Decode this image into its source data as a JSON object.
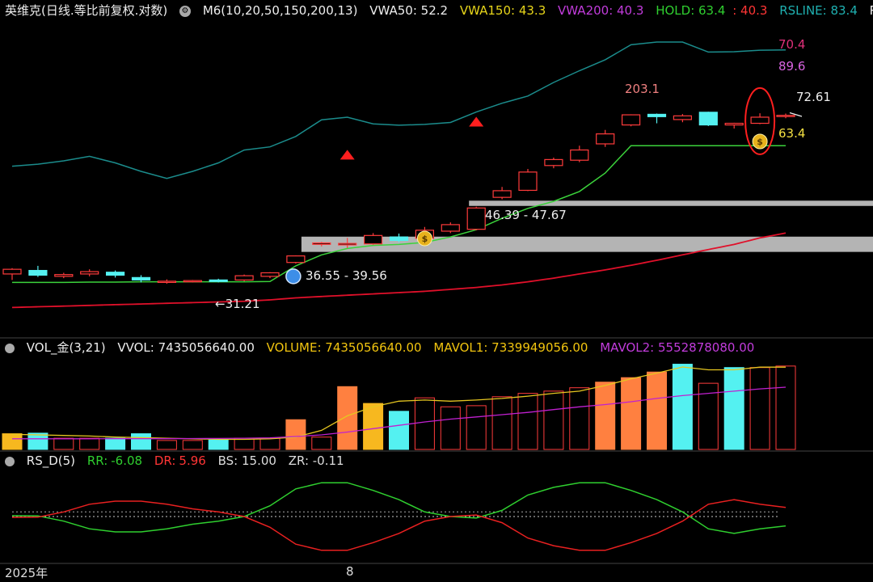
{
  "header_main": {
    "title": "英维克(日线.等比前复权.对数)",
    "m6": "M6(10,20,50,150,200,13)",
    "vwa50": "VWA50: 52.2",
    "vwa150": "VWA150: 43.3",
    "vwa200": "VWA200: 40.3",
    "hold": "HOLD: 63.4",
    "hold2": ": 40.3",
    "rsline": "RSLINE: 83.4",
    "rs_cut": "RS"
  },
  "header_vol": {
    "name": "VOL_金(3,21)",
    "vvol": "VVOL: 7435056640.00",
    "volume": "VOLUME: 7435056640.00",
    "mavol1": "MAVOL1: 7339949056.00",
    "mavol2": "MAVOL2: 5552878080.00"
  },
  "header_rs": {
    "name": "RS_D(5)",
    "rr_label": "RR:",
    "rr": "-6.08",
    "dr_label": "DR:",
    "dr": "5.96",
    "bs": "BS: 15.00",
    "zr": "ZR: -0.11"
  },
  "labels": {
    "l7041": "70.4",
    "l896": "89.6",
    "l2031": "203.1",
    "l7261": "72.61",
    "l634": "63.4",
    "l4639": "46.39 - 47.67",
    "l3655": "36.55 - 39.56",
    "l3121": "←31.21"
  },
  "dates": {
    "d1": "2025年",
    "d2": "8"
  },
  "colors": {
    "up": "#ff3b3b",
    "down": "#54f1f1",
    "hold": "#3bd23b",
    "rsline": "#1b8c8c",
    "vwa200": "#e0102a",
    "gold": "#f7b81f",
    "orange": "#ff8040",
    "magenta": "#c020d0"
  },
  "chart_data": [
    {
      "type": "candlestick",
      "title": "英维克(日线.等比前复权.对数)",
      "scale": "log",
      "candles": [
        {
          "o": 32.6,
          "h": 33.6,
          "l": 31.6,
          "c": 33.4
        },
        {
          "o": 33.2,
          "h": 34.0,
          "l": 32.1,
          "c": 32.4
        },
        {
          "o": 32.2,
          "h": 32.8,
          "l": 31.9,
          "c": 32.5
        },
        {
          "o": 32.6,
          "h": 33.4,
          "l": 32.2,
          "c": 33.0
        },
        {
          "o": 32.9,
          "h": 33.2,
          "l": 32.0,
          "c": 32.4
        },
        {
          "o": 32.0,
          "h": 32.4,
          "l": 31.2,
          "c": 31.6
        },
        {
          "o": 31.2,
          "h": 31.7,
          "l": 31.0,
          "c": 31.4
        },
        {
          "o": 31.4,
          "h": 31.6,
          "l": 31.2,
          "c": 31.5
        },
        {
          "o": 31.6,
          "h": 31.8,
          "l": 31.21,
          "c": 31.35
        },
        {
          "o": 31.6,
          "h": 32.5,
          "l": 31.4,
          "c": 32.3
        },
        {
          "o": 32.2,
          "h": 32.9,
          "l": 31.9,
          "c": 32.8
        },
        {
          "o": 34.6,
          "h": 35.9,
          "l": 34.4,
          "c": 35.8
        },
        {
          "o": 38.0,
          "h": 38.5,
          "l": 37.6,
          "c": 38.3
        },
        {
          "o": 37.9,
          "h": 39.3,
          "l": 37.3,
          "c": 38.2
        },
        {
          "o": 38.1,
          "h": 40.3,
          "l": 37.9,
          "c": 39.8
        },
        {
          "o": 39.5,
          "h": 40.2,
          "l": 38.4,
          "c": 38.8
        },
        {
          "o": 39.2,
          "h": 41.6,
          "l": 38.9,
          "c": 40.9
        },
        {
          "o": 40.7,
          "h": 42.6,
          "l": 40.3,
          "c": 42.1
        },
        {
          "o": 41.1,
          "h": 46.2,
          "l": 40.9,
          "c": 45.9
        },
        {
          "o": 48.5,
          "h": 51.2,
          "l": 48.0,
          "c": 50.2
        },
        {
          "o": 50.3,
          "h": 56.2,
          "l": 50.1,
          "c": 55.3
        },
        {
          "o": 57.2,
          "h": 59.6,
          "l": 56.4,
          "c": 59.0
        },
        {
          "o": 58.8,
          "h": 63.4,
          "l": 58.2,
          "c": 62.0
        },
        {
          "o": 64.0,
          "h": 68.8,
          "l": 63.0,
          "c": 67.4
        },
        {
          "o": 70.6,
          "h": 74.6,
          "l": 70.1,
          "c": 74.4
        },
        {
          "o": 74.6,
          "h": 74.9,
          "l": 71.2,
          "c": 73.7
        },
        {
          "o": 72.6,
          "h": 74.7,
          "l": 71.6,
          "c": 74.0
        },
        {
          "o": 75.4,
          "h": 75.6,
          "l": 70.2,
          "c": 70.6
        },
        {
          "o": 70.6,
          "h": 71.4,
          "l": 69.3,
          "c": 71.2
        },
        {
          "o": 71.2,
          "h": 75.0,
          "l": 70.9,
          "c": 73.5
        },
        {
          "o": 73.8,
          "h": 74.9,
          "l": 73.1,
          "c": 74.2
        }
      ],
      "lines": {
        "HOLD": [
          31.2,
          31.2,
          31.2,
          31.25,
          31.25,
          31.3,
          31.3,
          31.3,
          31.3,
          31.3,
          31.35,
          34.0,
          36.0,
          37.2,
          37.8,
          38.0,
          38.4,
          39.5,
          41.0,
          43.5,
          45.8,
          47.5,
          50.0,
          55.0,
          63.4,
          63.4,
          63.4,
          63.4,
          63.4,
          63.4,
          63.4
        ],
        "RSLINE": [
          57.0,
          57.6,
          58.6,
          60.0,
          58.0,
          55.5,
          53.5,
          55.5,
          58.0,
          62.0,
          63.0,
          66.5,
          72.5,
          73.5,
          71.0,
          70.5,
          70.8,
          71.5,
          75.5,
          79.0,
          82.0,
          88.0,
          93.5,
          99.0,
          107.0,
          108.5,
          108.5,
          103.0,
          103.2,
          104.0,
          104.2
        ],
        "VWA200": [
          27.4,
          27.5,
          27.6,
          27.7,
          27.8,
          27.9,
          28.0,
          28.1,
          28.2,
          28.3,
          28.5,
          28.8,
          29.0,
          29.2,
          29.4,
          29.6,
          29.8,
          30.1,
          30.4,
          30.8,
          31.3,
          31.9,
          32.6,
          33.3,
          34.1,
          35.0,
          36.0,
          37.0,
          38.0,
          39.3,
          40.3
        ]
      },
      "zones": [
        "46.39 - 47.67",
        "36.55 - 39.56"
      ],
      "annotations": [
        "70.4",
        "89.6",
        "203.1",
        "72.61",
        "63.4",
        "←31.21"
      ]
    },
    {
      "type": "bar",
      "title": "VOL_金(3,21)",
      "ylim": [
        0,
        8000000000
      ],
      "values": [
        1400000000,
        1450000000,
        1000000000,
        1000000000,
        1000000000,
        1400000000,
        800000000,
        800000000,
        850000000,
        1000000000,
        1000000000,
        2650000000,
        1100000000,
        5600000000,
        4100000000,
        3400000000,
        4600000000,
        3800000000,
        3900000000,
        4700000000,
        5000000000,
        5200000000,
        5500000000,
        6000000000,
        6400000000,
        6900000000,
        7600000000,
        5900000000,
        7300000000,
        7300000000,
        7435056640
      ],
      "colors": [
        "gold",
        "cyan",
        "red",
        "red",
        "cyan",
        "cyan",
        "red",
        "red",
        "cyan",
        "red",
        "red",
        "orange",
        "red",
        "orange",
        "gold",
        "cyan",
        "red",
        "red",
        "red",
        "red",
        "red",
        "red",
        "red",
        "orange",
        "orange",
        "orange",
        "cyan",
        "red",
        "cyan",
        "red",
        "red"
      ],
      "series": [
        {
          "name": "MAVOL1",
          "values": [
            1350000000,
            1300000000,
            1250000000,
            1200000000,
            1100000000,
            1050000000,
            1000000000,
            950000000,
            900000000,
            900000000,
            950000000,
            1100000000,
            1700000000,
            3000000000,
            3800000000,
            4300000000,
            4400000000,
            4300000000,
            4400000000,
            4550000000,
            4750000000,
            5000000000,
            5200000000,
            5700000000,
            6300000000,
            6800000000,
            7350000000,
            7100000000,
            7100000000,
            7339949056,
            7339949056
          ]
        },
        {
          "name": "MAVOL2",
          "values": [
            950000000,
            950000000,
            950000000,
            950000000,
            960000000,
            960000000,
            960000000,
            970000000,
            980000000,
            1000000000,
            1030000000,
            1150000000,
            1300000000,
            1550000000,
            1850000000,
            2150000000,
            2450000000,
            2700000000,
            2900000000,
            3100000000,
            3300000000,
            3550000000,
            3800000000,
            4000000000,
            4250000000,
            4550000000,
            4800000000,
            5000000000,
            5200000000,
            5400000000,
            5552878080
          ]
        }
      ]
    },
    {
      "type": "line",
      "title": "RS_D(5)",
      "ylim": [
        -30,
        30
      ],
      "series": [
        {
          "name": "RR",
          "values": [
            0.5,
            0.4,
            -3.0,
            -8.0,
            -10.0,
            -10.0,
            -8.0,
            -5.0,
            -3.0,
            0.0,
            7.0,
            18.0,
            22.0,
            22.0,
            17.0,
            11.0,
            3.0,
            0.0,
            -1.0,
            4.0,
            14.0,
            19.0,
            22.0,
            22.0,
            17.0,
            11.0,
            3.0,
            -8.0,
            -11.0,
            -8.0,
            -6.08
          ]
        },
        {
          "name": "DR",
          "values": [
            -0.5,
            -0.4,
            3.0,
            8.0,
            10.0,
            10.0,
            8.0,
            5.0,
            3.0,
            0.0,
            -7.0,
            -18.0,
            -22.0,
            -22.0,
            -17.0,
            -11.0,
            -3.0,
            0.0,
            1.0,
            -4.0,
            -14.0,
            -19.0,
            -22.0,
            -22.0,
            -17.0,
            -11.0,
            -3.0,
            8.0,
            11.0,
            8.0,
            5.96
          ]
        }
      ]
    }
  ]
}
